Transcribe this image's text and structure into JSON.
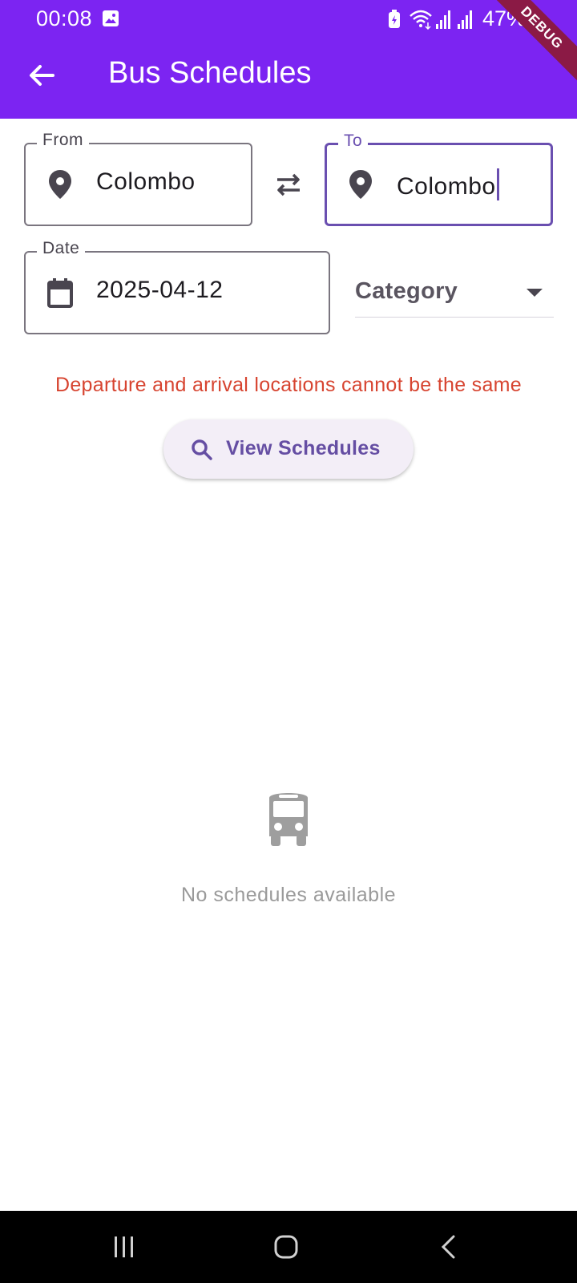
{
  "status_bar": {
    "time": "00:08",
    "battery_percent": "47%"
  },
  "debug_banner": "DEBUG",
  "app_bar": {
    "title": "Bus Schedules",
    "back_icon": "arrow-back-icon"
  },
  "form": {
    "from": {
      "label": "From",
      "value": "Colombo",
      "icon": "location-pin-icon"
    },
    "to": {
      "label": "To",
      "value": "Colombo",
      "icon": "location-pin-icon"
    },
    "swap_icon": "swap-horiz-icon",
    "date": {
      "label": "Date",
      "value": "2025-04-12",
      "icon": "calendar-icon"
    },
    "category": {
      "placeholder": "Category",
      "icon": "dropdown-arrow-icon"
    }
  },
  "error_message": "Departure and arrival locations cannot be the same",
  "view_button": {
    "label": "View Schedules",
    "icon": "search-icon"
  },
  "empty_state": {
    "icon": "bus-icon",
    "message": "No schedules available"
  },
  "colors": {
    "primary": "#7c24f2",
    "focus_border": "#6a4fb0",
    "error": "#d74430",
    "button_bg": "#f3eef7",
    "button_text": "#654ea3"
  }
}
